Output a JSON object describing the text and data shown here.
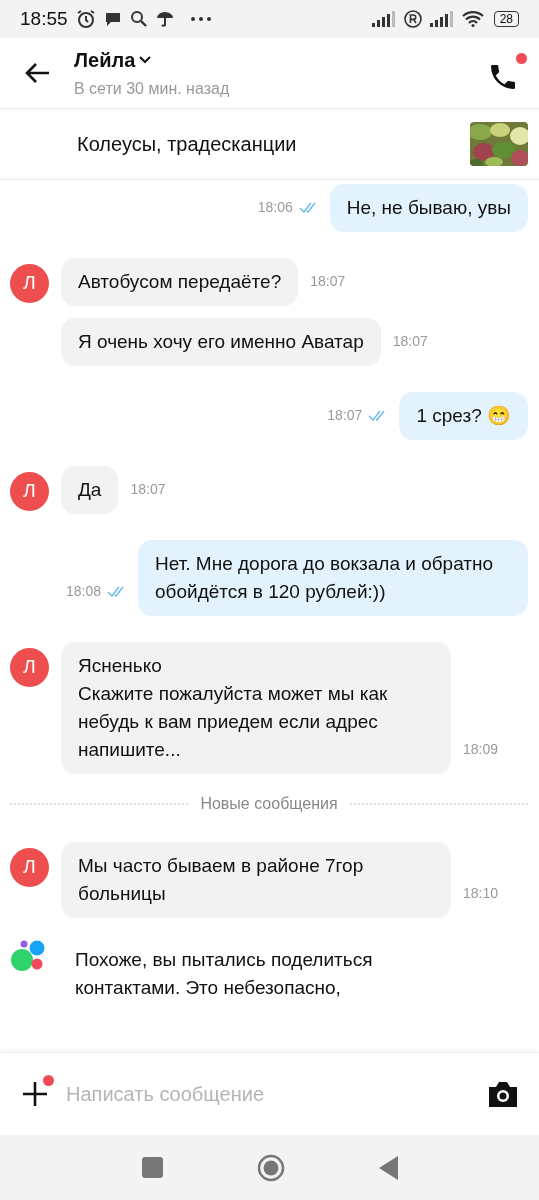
{
  "status_bar": {
    "time": "18:55",
    "battery": "28"
  },
  "header": {
    "name": "Лейла",
    "subtitle": "В сети 30 мин. назад",
    "call_badge": true
  },
  "listing": {
    "title": "Колеусы, традесканции"
  },
  "messages": [
    {
      "kind": "outgoing",
      "text": "Не, не бываю, увы",
      "time": "18:06",
      "read": true
    },
    {
      "kind": "incoming",
      "avatar": "Л",
      "show_avatar": true,
      "text": "Автобусом передаёте?",
      "time": "18:07"
    },
    {
      "kind": "incoming",
      "show_avatar": false,
      "text": "Я очень хочу его именно Аватар",
      "time": "18:07"
    },
    {
      "kind": "outgoing",
      "text": "1 срез? 😁",
      "time": "18:07",
      "read": true
    },
    {
      "kind": "incoming",
      "avatar": "Л",
      "show_avatar": true,
      "text": "Да",
      "time": "18:07"
    },
    {
      "kind": "outgoing",
      "text": "Нет. Мне дорога до вокзала и обратно обойдётся в 120 рублей:))",
      "time": "18:08",
      "read": true
    },
    {
      "kind": "incoming",
      "avatar": "Л",
      "show_avatar": true,
      "text": "Ясненько\nСкажите пожалуйста может мы как небудь к вам приедем если адрес напишите...",
      "time": "18:09"
    },
    {
      "kind": "separator",
      "text": "Новые сообщения"
    },
    {
      "kind": "incoming",
      "avatar": "Л",
      "show_avatar": true,
      "text": "Мы часто бываем в районе 7гор больницы",
      "time": "18:10"
    },
    {
      "kind": "system",
      "text": "Похоже, вы пытались поделиться контактами. Это небезопасно,"
    }
  ],
  "composer": {
    "placeholder": "Написать сообщение",
    "attach_badge": true
  }
}
